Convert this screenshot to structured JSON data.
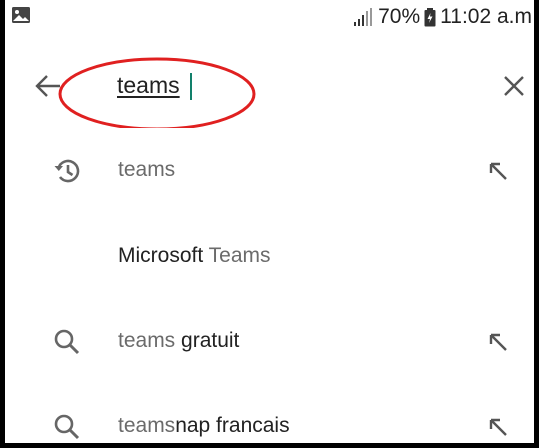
{
  "status_bar": {
    "battery": "70%",
    "time": "11:02 a.m"
  },
  "search": {
    "query": "teams"
  },
  "icons": {
    "back": "arrow-back-icon",
    "clear": "close-icon",
    "history": "history-icon",
    "search": "search-icon",
    "fill": "arrow-up-left-icon"
  },
  "colors": {
    "cursor": "#12806b",
    "annotation": "#e02020"
  },
  "suggestions": [
    {
      "kind": "history",
      "dim_part": "teams",
      "bold_part": ""
    },
    {
      "kind": "app",
      "bold_part": "Microsoft",
      "dim_part": "Teams"
    },
    {
      "kind": "search",
      "dim_part": "teams",
      "bold_part": "gratuit"
    },
    {
      "kind": "search",
      "dim_part": "teams",
      "bold_part": "nap francais"
    }
  ]
}
